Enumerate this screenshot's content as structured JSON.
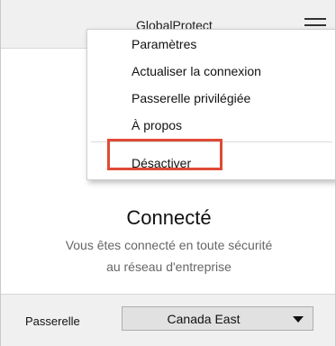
{
  "app": {
    "title": "GlobalProtect"
  },
  "menu": {
    "items": [
      {
        "label": "Paramètres"
      },
      {
        "label": "Actualiser la connexion"
      },
      {
        "label": "Passerelle privilégiée"
      },
      {
        "label": "À propos"
      },
      {
        "label": "Désactiver"
      }
    ],
    "highlighted_item": "Désactiver",
    "highlight_color": "#e04a35"
  },
  "status": {
    "title": "Connecté",
    "line1": "Vous êtes connecté en toute sécurité",
    "line2": "au réseau d'entreprise"
  },
  "footer": {
    "gateway_label": "Passerelle",
    "gateway_value": "Canada East"
  },
  "icons": {
    "menu": "hamburger-menu-icon",
    "dropdown": "chevron-down-icon"
  }
}
